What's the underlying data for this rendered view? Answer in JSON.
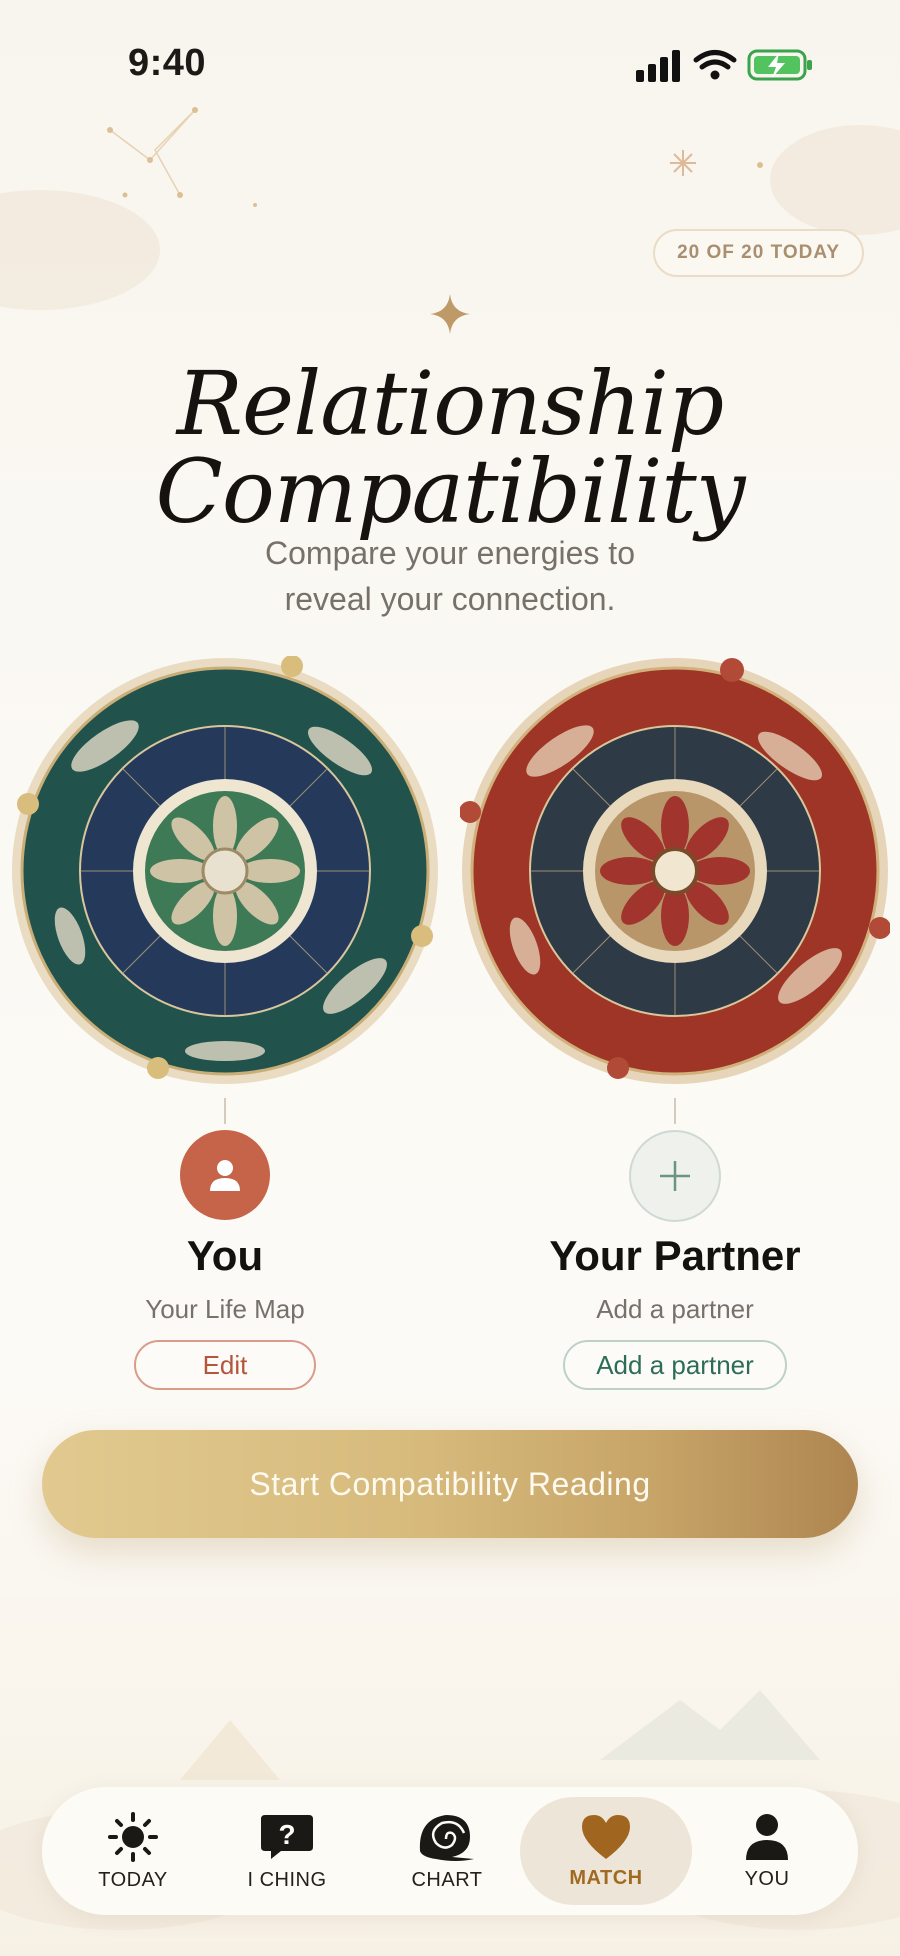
{
  "status_bar": {
    "time": "9:40"
  },
  "counter": "20 OF 20 TODAY",
  "title": "Relationship Compatibility",
  "subtitle_line1": "Compare your energies to",
  "subtitle_line2": "reveal your connection.",
  "you": {
    "name": "You",
    "subtitle": "Your Life Map",
    "button": "Edit"
  },
  "partner": {
    "name": "Your Partner",
    "subtitle": "Add a partner",
    "button": "Add a partner"
  },
  "cta": "Start Compatibility Reading",
  "tabs": [
    {
      "label": "TODAY",
      "icon": "sun-icon"
    },
    {
      "label": "I CHING",
      "icon": "question-bubble-icon"
    },
    {
      "label": "CHART",
      "icon": "shell-icon"
    },
    {
      "label": "MATCH",
      "icon": "heart-icon",
      "active": true
    },
    {
      "label": "YOU",
      "icon": "person-icon"
    }
  ],
  "colors": {
    "accent_gold": "#c7a468",
    "you_avatar": "#c56448",
    "active_tab": "#a06a21"
  }
}
